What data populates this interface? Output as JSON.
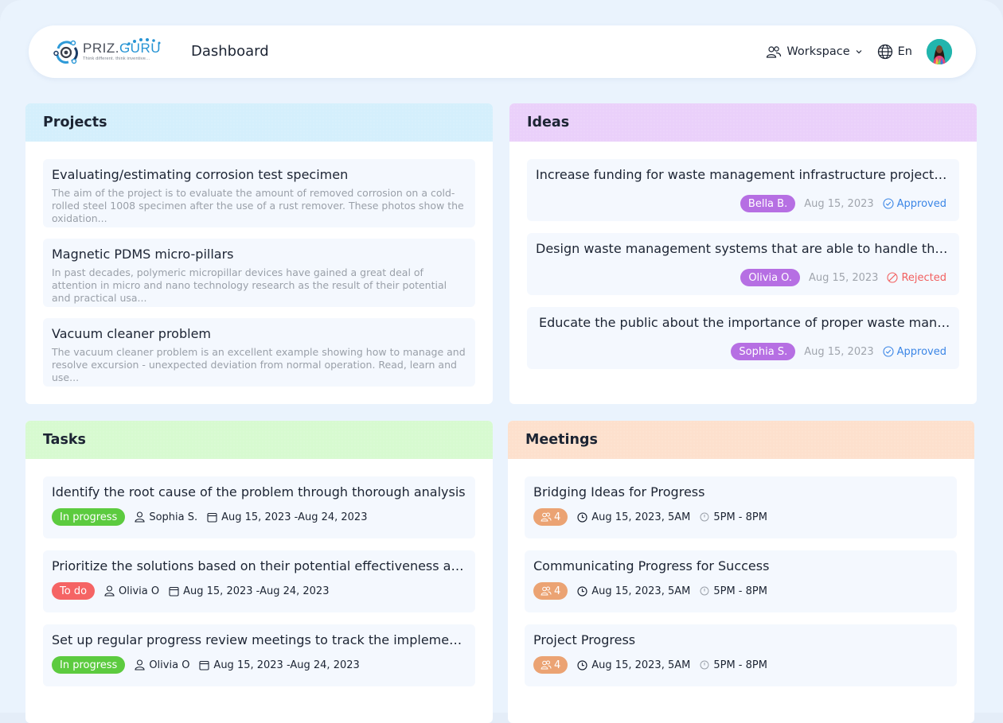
{
  "header": {
    "logo": {
      "brand_a": "PRIZ.",
      "brand_b": "GURU",
      "tagline": "Think different. think inventive..."
    },
    "title": "Dashboard",
    "workspace_label": "Workspace",
    "language_label": "En",
    "icons": {
      "workspace": "users-icon",
      "chevron": "chevron-down-icon",
      "language": "globe-icon",
      "avatar": "user-avatar"
    }
  },
  "projects": {
    "title": "Projects",
    "items": [
      {
        "title": "Evaluating/estimating corrosion test specimen",
        "description": "The aim of the project is to evaluate the amount of removed corrosion on a cold-rolled steel 1008 specimen after the use of a rust remover. These photos show the oxidation..."
      },
      {
        "title": "Magnetic PDMS micro-pillars",
        "description": "In past decades, polymeric micropillar devices have gained a great deal of attention in micro and nano technology research as the result of their potential and practical usa..."
      },
      {
        "title": "Vacuum cleaner problem",
        "description": "The vacuum cleaner problem is an excellent example showing how to manage and resolve excursion - unexpected deviation from normal operation. Read, learn and use..."
      }
    ]
  },
  "ideas": {
    "title": "Ideas",
    "items": [
      {
        "title": "Increase funding for waste management infrastructure projects...",
        "author": "Bella B.",
        "date": "Aug 15, 2023",
        "status": "Approved",
        "status_icon": "check-circle-icon"
      },
      {
        "title": "Design waste management systems that are able to handle the volu...",
        "author": "Olivia O.",
        "date": "Aug 15, 2023",
        "status": "Rejected",
        "status_icon": "ban-icon"
      },
      {
        "title": "Educate the public about the importance of proper waste manage...",
        "author": "Sophia S.",
        "date": "Aug 15, 2023",
        "status": "Approved",
        "status_icon": "check-circle-icon"
      }
    ]
  },
  "tasks": {
    "title": "Tasks",
    "items": [
      {
        "title": "Identify the root cause of the problem through thorough analysis",
        "status": "In progress",
        "assignee": "Sophia S.",
        "dates": "Aug 15, 2023 -Aug 24, 2023"
      },
      {
        "title": "Prioritize the solutions based on their potential effectiveness and re...",
        "status": "To do",
        "assignee": "Olivia O",
        "dates": "Aug 15, 2023 -Aug 24, 2023"
      },
      {
        "title": "Set up regular progress review meetings to track the implementatio...",
        "status": "In progress",
        "assignee": "Olivia O",
        "dates": "Aug 15, 2023 -Aug 24, 2023"
      }
    ]
  },
  "meetings": {
    "title": "Meetings",
    "items": [
      {
        "title": "Bridging Ideas for Progress",
        "participants": "4",
        "datetime": "Aug 15, 2023, 5AM",
        "duration": "5PM - 8PM"
      },
      {
        "title": "Communicating Progress for Success",
        "participants": "4",
        "datetime": "Aug 15, 2023, 5AM",
        "duration": "5PM - 8PM"
      },
      {
        "title": "Project Progress",
        "participants": "4",
        "datetime": "Aug 15, 2023, 5AM",
        "duration": "5PM - 8PM"
      }
    ]
  },
  "colors": {
    "projects_header": "#d4effc",
    "ideas_header": "#ead0fa",
    "tasks_header": "#d7fad0",
    "meetings_header": "#fde0cd",
    "in_progress": "#5ccb3f",
    "to_do": "#f56464",
    "user_pill": "#b66fe3",
    "participants_pill": "#eba373",
    "approved": "#3b86e6",
    "rejected": "#f26060"
  }
}
